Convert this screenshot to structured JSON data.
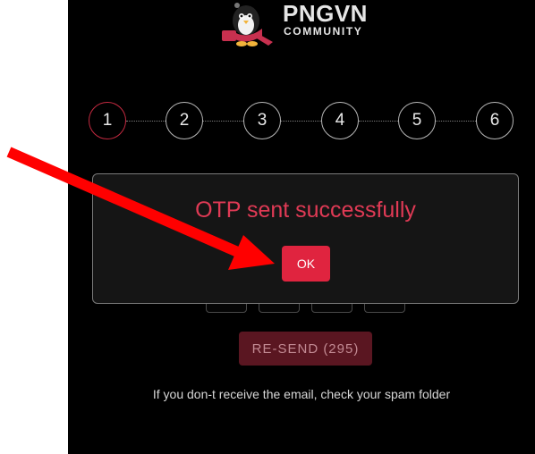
{
  "logo": {
    "name": "PNGVN",
    "subtitle": "COMMUNITY"
  },
  "stepper": {
    "steps": [
      "1",
      "2",
      "3",
      "4",
      "5",
      "6"
    ],
    "active_step": 1
  },
  "modal": {
    "message": "OTP sent successfully",
    "ok_label": "OK"
  },
  "otp": {
    "resend_label": "RE-SEND (295)",
    "hint": "If you don-t receive the email, check your spam folder"
  },
  "colors": {
    "background": "#000000",
    "accent": "#e0243f",
    "message": "#e03a55",
    "disabled_button": "#5a1621",
    "annotation_arrow": "#ff0000"
  }
}
